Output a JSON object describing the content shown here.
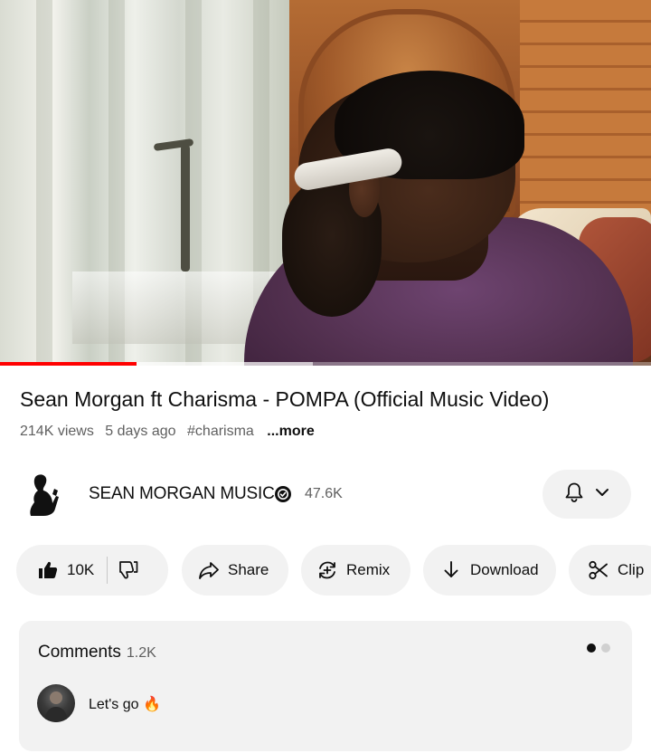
{
  "video": {
    "scene_alt": "music video frame",
    "progress_fraction": 0.21,
    "buffered_fraction": 0.48
  },
  "colors": {
    "progress_played": "#ff0000",
    "pill_bg": "#f2f2f2",
    "secondary_text": "#606060",
    "dot_active": "#0f0f0f",
    "dot_inactive": "#d0d0d0"
  },
  "title": "Sean Morgan ft Charisma - POMPA (Official Music Video)",
  "meta": {
    "views": "214K views",
    "age": "5 days ago",
    "hashtag": "#charisma",
    "more": "...more"
  },
  "channel": {
    "name": "SEAN MORGAN MUSIC",
    "subscribers": "47.6K",
    "verified_icon": "verified-check-icon",
    "bell_icon": "bell-icon",
    "chevron_icon": "chevron-down-icon"
  },
  "actions": {
    "like_count": "10K",
    "share_label": "Share",
    "remix_label": "Remix",
    "download_label": "Download",
    "clip_label": "Clip"
  },
  "comments": {
    "label": "Comments",
    "count": "1.2K",
    "top_comment": "Let's go 🔥",
    "page_total": 2,
    "page_active": 1
  }
}
